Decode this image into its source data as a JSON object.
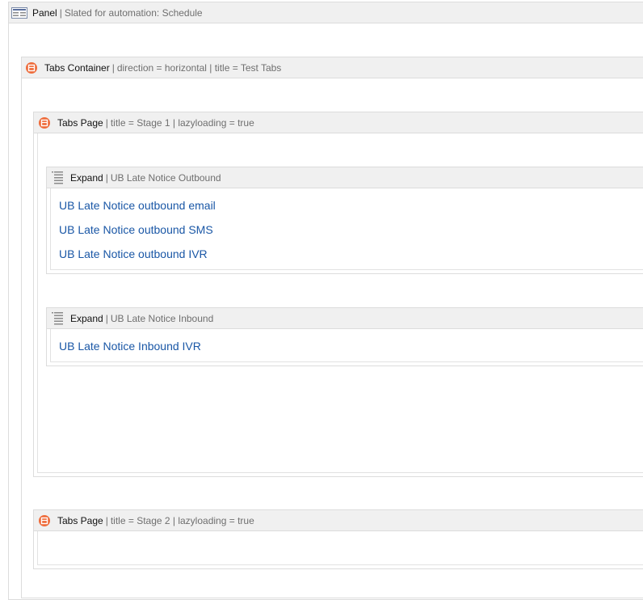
{
  "panel": {
    "title": "Panel",
    "meta": "Slated for automation: Schedule"
  },
  "tabs_container": {
    "title": "Tabs Container",
    "meta": "direction = horizontal | title = Test Tabs"
  },
  "tabs_page_1": {
    "title": "Tabs Page",
    "meta": "title = Stage 1 | lazyloading = true"
  },
  "expand_outbound": {
    "title": "Expand",
    "meta": "UB Late Notice Outbound",
    "links": [
      "UB Late Notice outbound email",
      "UB Late Notice outbound SMS",
      "UB Late Notice outbound IVR"
    ]
  },
  "expand_inbound": {
    "title": "Expand",
    "meta": "UB Late Notice Inbound",
    "links": [
      "UB Late Notice Inbound IVR"
    ]
  },
  "tabs_page_2": {
    "title": "Tabs Page",
    "meta": "title = Stage 2 | lazyloading = true"
  },
  "icons": {
    "panel": "panel-icon",
    "component": "component-icon",
    "expand": "list-icon"
  },
  "colors": {
    "link": "#1a57a6",
    "icon_orange": "#ee6b3a",
    "header_bg": "#f0f0f0",
    "border": "#dcdcdc"
  }
}
